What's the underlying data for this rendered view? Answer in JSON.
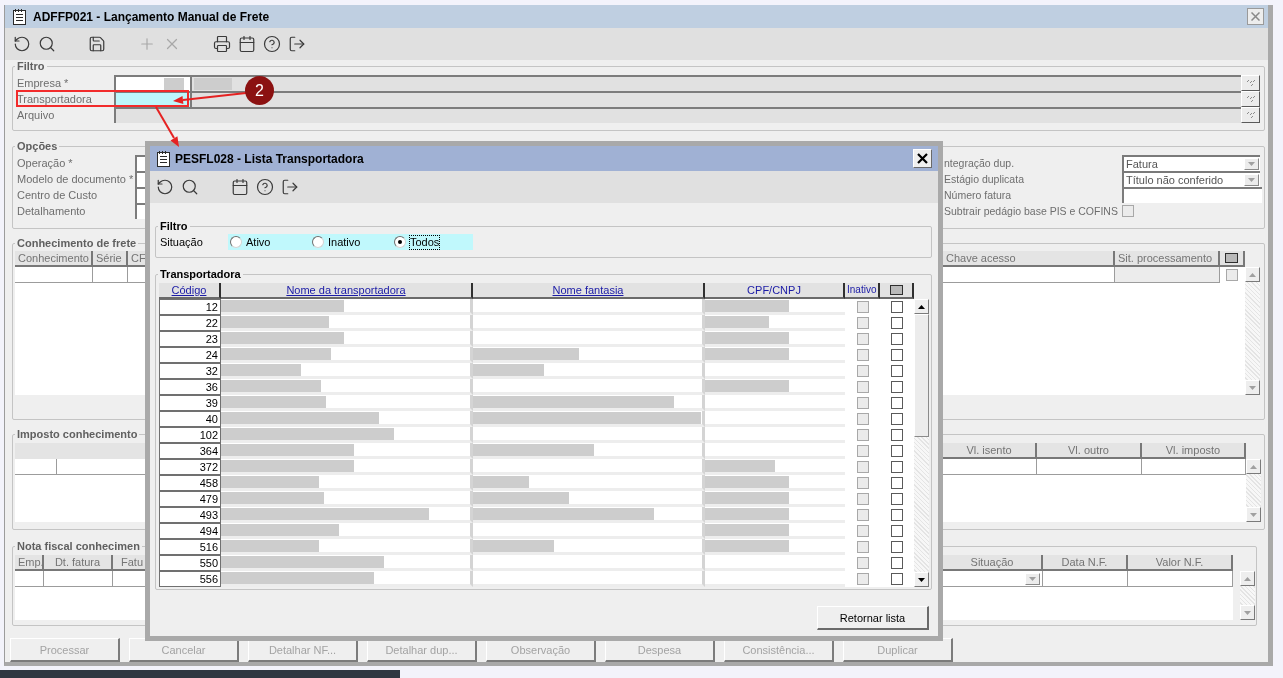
{
  "window": {
    "title": "ADFFP021 - Lançamento Manual de Frete"
  },
  "toolbar": [
    {
      "disabled": false
    },
    {
      "disabled": false
    },
    {
      "disabled": false
    },
    {
      "disabled": true
    },
    {
      "disabled": true
    },
    {
      "disabled": false
    },
    {
      "disabled": false
    },
    {
      "disabled": false
    },
    {
      "disabled": false
    }
  ],
  "filter": {
    "title": "Filtro",
    "fields": [
      {
        "label": "Empresa *",
        "kind": "code_lookup",
        "focused": false,
        "redacted": true
      },
      {
        "label": "Transportadora",
        "kind": "code_lookup",
        "focused": true,
        "redacted": false
      },
      {
        "label": "Arquivo",
        "kind": "path",
        "focused": false,
        "redacted": false
      }
    ]
  },
  "options": {
    "title": "Opções",
    "left_fields": [
      {
        "label": "Operação *"
      },
      {
        "label": "Modelo de documento *"
      },
      {
        "label": "Centro de Custo"
      },
      {
        "label": "Detalhamento"
      }
    ],
    "right_fields": [
      {
        "label": "ntegração dup.",
        "kind": "select",
        "value": "Fatura"
      },
      {
        "label": "Estágio duplicata",
        "kind": "select",
        "value": "Título não conferido"
      },
      {
        "label": "Número fatura",
        "kind": "input"
      },
      {
        "label": "Subtrair pedágio base PIS e COFINS",
        "kind": "checkbox",
        "checked": false
      }
    ]
  },
  "freight_bills": {
    "title": "Conhecimento de frete",
    "left_columns": [
      "Conhecimento",
      "Série",
      "CF"
    ],
    "right_columns": [
      "Chave acesso",
      "Sit. processamento"
    ],
    "rows": [
      {
        "checked": false
      }
    ]
  },
  "taxes": {
    "title": "Imposto conhecimento",
    "right_columns": [
      "Vl. isento",
      "Vl. outro",
      "Vl. imposto"
    ]
  },
  "invoices": {
    "title": "Nota fiscal conhecimen",
    "left_columns": [
      "Emp.",
      "Dt. fatura",
      "Fatu"
    ],
    "right_columns": [
      "Situação",
      "Data N.F.",
      "Valor N.F."
    ]
  },
  "buttons": [
    {
      "label": "Processar",
      "disabled": true
    },
    {
      "label": "Cancelar",
      "disabled": true
    },
    {
      "label": "Detalhar NF...",
      "disabled": true
    },
    {
      "label": "Detalhar dup...",
      "disabled": true
    },
    {
      "label": "Observação",
      "disabled": true
    },
    {
      "label": "Despesa",
      "disabled": true
    },
    {
      "label": "Consistência...",
      "disabled": true
    },
    {
      "label": "Duplicar",
      "disabled": true
    }
  ],
  "annotation": {
    "number": "2"
  },
  "dialog": {
    "title": "PESFL028 - Lista Transportadora",
    "toolbar": [
      {
        "disabled": false
      },
      {
        "disabled": false
      },
      {
        "disabled": false
      },
      {
        "disabled": false
      },
      {
        "disabled": false
      }
    ],
    "filter": {
      "title": "Filtro",
      "label": "Situação",
      "options": [
        {
          "label": "Ativo",
          "selected": false
        },
        {
          "label": "Inativo",
          "selected": false
        },
        {
          "label": "Todos",
          "selected": true
        }
      ]
    },
    "list": {
      "title": "Transportadora",
      "columns": [
        "Código",
        "Nome da transportadora",
        "Nome fantasia",
        "CPF/CNPJ",
        "Inativo"
      ],
      "rows": [
        {
          "code": "12",
          "name_redacted": true,
          "trade_name_redacted": false,
          "tax_id_redacted": true,
          "inactive": false,
          "checked": false
        },
        {
          "code": "22",
          "name_redacted": true,
          "trade_name_redacted": false,
          "tax_id_redacted": true,
          "inactive": false,
          "checked": false
        },
        {
          "code": "23",
          "name_redacted": true,
          "trade_name_redacted": false,
          "tax_id_redacted": true,
          "inactive": false,
          "checked": false
        },
        {
          "code": "24",
          "name_redacted": true,
          "trade_name_redacted": true,
          "tax_id_redacted": true,
          "inactive": false,
          "checked": false
        },
        {
          "code": "32",
          "name_redacted": true,
          "trade_name_redacted": true,
          "tax_id_redacted": false,
          "inactive": false,
          "checked": false
        },
        {
          "code": "36",
          "name_redacted": true,
          "trade_name_redacted": false,
          "tax_id_redacted": true,
          "inactive": false,
          "checked": false
        },
        {
          "code": "39",
          "name_redacted": true,
          "trade_name_redacted": true,
          "tax_id_redacted": false,
          "inactive": false,
          "checked": false
        },
        {
          "code": "40",
          "name_redacted": true,
          "trade_name_redacted": true,
          "tax_id_redacted": false,
          "inactive": false,
          "checked": false
        },
        {
          "code": "102",
          "name_redacted": true,
          "trade_name_redacted": false,
          "tax_id_redacted": false,
          "inactive": false,
          "checked": false
        },
        {
          "code": "364",
          "name_redacted": true,
          "trade_name_redacted": true,
          "tax_id_redacted": false,
          "inactive": false,
          "checked": false
        },
        {
          "code": "372",
          "name_redacted": true,
          "trade_name_redacted": false,
          "tax_id_redacted": true,
          "inactive": false,
          "checked": false
        },
        {
          "code": "458",
          "name_redacted": true,
          "trade_name_redacted": true,
          "tax_id_redacted": true,
          "inactive": false,
          "checked": false
        },
        {
          "code": "479",
          "name_redacted": true,
          "trade_name_redacted": true,
          "tax_id_redacted": true,
          "inactive": false,
          "checked": false
        },
        {
          "code": "493",
          "name_redacted": true,
          "trade_name_redacted": true,
          "tax_id_redacted": true,
          "inactive": false,
          "checked": false
        },
        {
          "code": "494",
          "name_redacted": true,
          "trade_name_redacted": false,
          "tax_id_redacted": true,
          "inactive": false,
          "checked": false
        },
        {
          "code": "516",
          "name_redacted": true,
          "trade_name_redacted": true,
          "tax_id_redacted": true,
          "inactive": false,
          "checked": false
        },
        {
          "code": "550",
          "name_redacted": true,
          "trade_name_redacted": false,
          "tax_id_redacted": false,
          "inactive": false,
          "checked": false
        },
        {
          "code": "556",
          "name_redacted": true,
          "trade_name_redacted": false,
          "tax_id_redacted": false,
          "inactive": false,
          "checked": false
        }
      ]
    },
    "button": "Retornar lista"
  }
}
